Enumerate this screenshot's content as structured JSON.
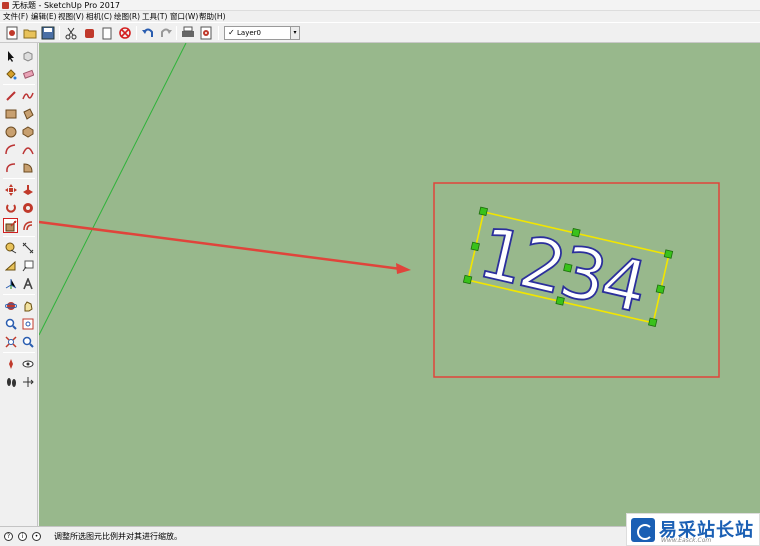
{
  "window": {
    "title": "无标题 - SketchUp Pro 2017"
  },
  "menu": [
    "文件(F)",
    "编辑(E)",
    "视图(V)",
    "相机(C)",
    "绘图(R)",
    "工具(T)",
    "窗口(W)",
    "帮助(H)"
  ],
  "toolbar": {
    "layer": {
      "name": "Layer0",
      "checked": "✓",
      "dropdown": "▾"
    }
  },
  "canvas": {
    "text_value": "1234",
    "background": "#98b88c",
    "highlight_color": "#e0443b",
    "selection_color": "#f2e600",
    "grip_color": "#39c21b"
  },
  "status": {
    "message": "调整所选图元比例并对其进行缩放。"
  },
  "watermark": {
    "text": "易采站长站",
    "url": "Www.Easck.Com"
  }
}
